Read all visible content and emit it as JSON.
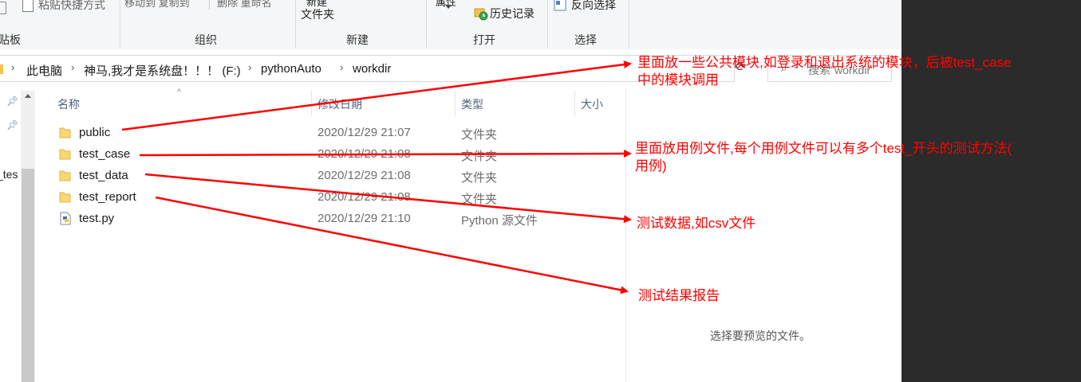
{
  "ribbon": {
    "paste_shortcut": "粘贴快捷方式",
    "move_copy": "移动到 复制到",
    "delete_rename": "删除 重命名",
    "new_item": "新建",
    "new_folder": "文件夹",
    "properties": "属性",
    "history": "历史记录",
    "invert_selection": "反向选择",
    "groups": {
      "clipboard": "贴板",
      "organize": "组织",
      "new": "新建",
      "open": "打开",
      "select": "选择"
    }
  },
  "address": {
    "crumbs": [
      "此电脑",
      "神马,我才是系统盘！！！ (F:)",
      "pythonAuto",
      "workdir"
    ],
    "search_placeholder": "搜索\"workdir\""
  },
  "nav": {
    "truncated_item": "_tes"
  },
  "columns": {
    "name": "名称",
    "modified": "修改日期",
    "type": "类型",
    "size": "大小"
  },
  "files": [
    {
      "name": "public",
      "modified": "2020/12/29 21:07",
      "type": "文件夹",
      "icon": "folder-icon"
    },
    {
      "name": "test_case",
      "modified": "2020/12/29 21:08",
      "type": "文件夹",
      "icon": "folder-icon"
    },
    {
      "name": "test_data",
      "modified": "2020/12/29 21:08",
      "type": "文件夹",
      "icon": "folder-icon"
    },
    {
      "name": "test_report",
      "modified": "2020/12/29 21:08",
      "type": "文件夹",
      "icon": "folder-icon"
    },
    {
      "name": "test.py",
      "modified": "2020/12/29 21:10",
      "type": "Python 源文件",
      "icon": "python-file-icon"
    }
  ],
  "preview": {
    "message": "选择要预览的文件。"
  },
  "annotations": [
    {
      "line1": "里面放一些公共模块,如登录和退出系统的模块，后被test_case",
      "line2": "中的模块调用"
    },
    {
      "line1": "里面放用例文件,每个用例文件可以有多个test_开头的测试方法(",
      "line2": "用例)"
    },
    {
      "line1": "测试数据,如csv文件",
      "line2": ""
    },
    {
      "line1": "测试结果报告",
      "line2": ""
    }
  ],
  "colors": {
    "annotation": "#ff0000",
    "folder": "#f8d775",
    "header_text": "#4d6082",
    "secondary_text": "#6d6d6d"
  }
}
